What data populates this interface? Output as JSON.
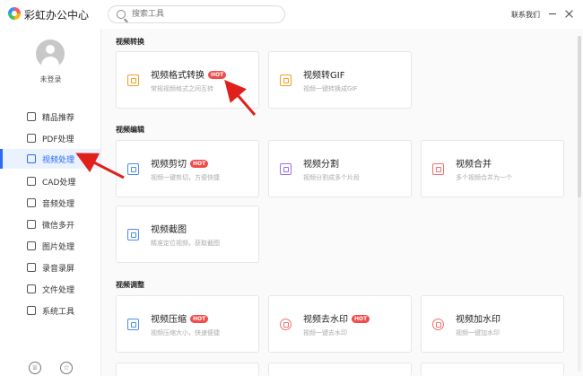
{
  "app": {
    "title": "彩虹办公中心"
  },
  "search": {
    "placeholder": "搜索工具"
  },
  "header": {
    "contact": "联系我们"
  },
  "user": {
    "login": "未登录"
  },
  "sidebar": {
    "items": [
      {
        "label": "精品推荐",
        "icon": "thumbs-up-icon"
      },
      {
        "label": "PDF处理",
        "icon": "pdf-icon"
      },
      {
        "label": "视频处理",
        "icon": "video-icon",
        "active": true
      },
      {
        "label": "CAD处理",
        "icon": "cad-icon"
      },
      {
        "label": "音频处理",
        "icon": "music-icon"
      },
      {
        "label": "微信多开",
        "icon": "wechat-icon"
      },
      {
        "label": "图片处理",
        "icon": "image-icon"
      },
      {
        "label": "录音录屏",
        "icon": "record-icon"
      },
      {
        "label": "文件处理",
        "icon": "folder-icon"
      },
      {
        "label": "系统工具",
        "icon": "system-icon"
      }
    ]
  },
  "sections": [
    {
      "title": "视频转换",
      "cards": [
        {
          "title": "视频格式转换",
          "desc": "常规视频格式之间互转",
          "hot": "HOT"
        },
        {
          "title": "视频转GIF",
          "desc": "视频一键转换成GIF"
        }
      ]
    },
    {
      "title": "视频编辑",
      "cards": [
        {
          "title": "视频剪切",
          "desc": "视频一键剪切，方便快捷",
          "hot": "HOT"
        },
        {
          "title": "视频分割",
          "desc": "视频分割成多个片段"
        },
        {
          "title": "视频合并",
          "desc": "多个视频合并为一个"
        },
        {
          "title": "视频截图",
          "desc": "精准定位视频，获取截图"
        }
      ]
    },
    {
      "title": "视频调整",
      "cards": [
        {
          "title": "视频压缩",
          "desc": "视频压缩大小，快速便捷",
          "hot": "HOT"
        },
        {
          "title": "视频去水印",
          "desc": "视频一键去水印",
          "hot": "HOT"
        },
        {
          "title": "视频加水印",
          "desc": "视频一键加水印"
        }
      ]
    }
  ],
  "colors": {
    "accent": "#2b6cf6",
    "hot_badge": "#f24b4b",
    "annotation_arrow": "#e0201a"
  }
}
